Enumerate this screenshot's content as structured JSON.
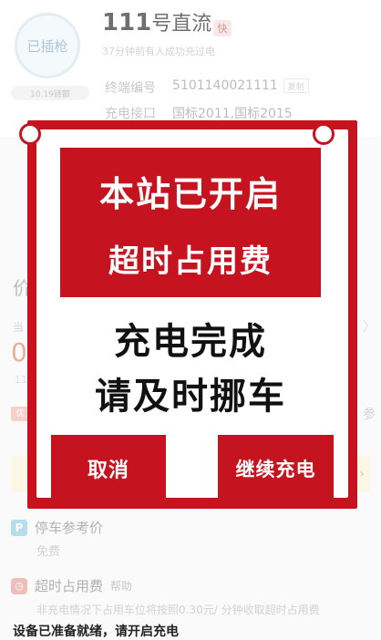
{
  "station": {
    "plug_status": "已插枪",
    "power_label": "10.19链额",
    "title_num": "111",
    "title_text": "号直流",
    "fast_badge": "快",
    "recent_charge": "37分钟前有人成功充过电",
    "terminal_label": "终端编号",
    "terminal_value": "5101140021111",
    "copy_label": "复制",
    "interface_label": "充电接口",
    "interface_value": "国标2011,国标2015"
  },
  "pricing": {
    "heading": "价",
    "current_label": "当",
    "big_value": "0",
    "small_value": "11",
    "promo_chip": "优",
    "right_fragment_1": "〉",
    "right_fragment_2": "参"
  },
  "parking": {
    "icon_letter": "P",
    "title": "停车参考价",
    "value": "免费"
  },
  "overtime": {
    "title": "超时占用费",
    "help": "帮助",
    "description": "非充电情况下占用车位将按照0.30元/ 分钟收取超时占用费"
  },
  "status_text": "设备已准备就绪，请开启充电",
  "modal": {
    "banner_line1": "本站已开启",
    "banner_line2": "超时占用费",
    "message_line1": "充电完成",
    "message_line2": "请及时挪车",
    "cancel_label": "取消",
    "continue_label": "继续充电"
  },
  "colors": {
    "modal_red": "#c5141f",
    "accent_blue": "#8ecbe0"
  }
}
